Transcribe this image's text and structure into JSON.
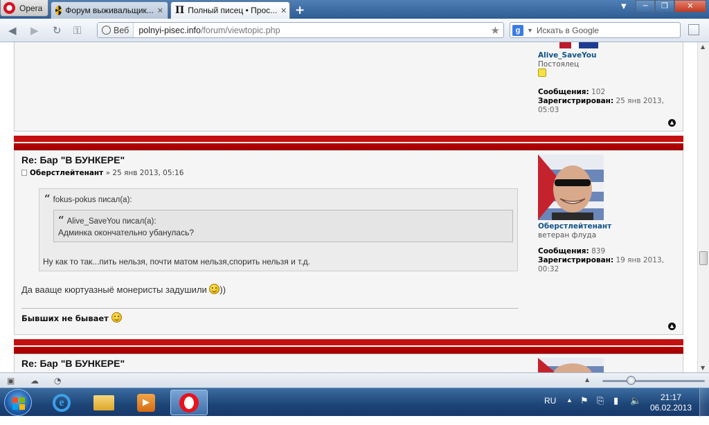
{
  "browser": {
    "opera_button": "Opera",
    "tabs": [
      {
        "label": "Форум выживальщик..."
      },
      {
        "label": "Полный писец • Прос..."
      }
    ],
    "win": {
      "min": "─",
      "max": "❐",
      "close": "✕"
    }
  },
  "address": {
    "badge": "Веб",
    "url_host": "polnyi-pisec.info",
    "url_path": "/forum/viewtopic.php",
    "search_placeholder": "Искать в Google"
  },
  "post_prev": {
    "username": "Alive_SaveYou",
    "rank": "Постоялец",
    "posts_label": "Сообщения:",
    "posts_value": "102",
    "reg_label": "Зарегистрирован:",
    "reg_value": "25 янв 2013, 05:03"
  },
  "post_main": {
    "title": "Re: Бар \"В БУНКЕРЕ\"",
    "author": "Оберстлейтенант",
    "date": "» 25 янв 2013, 05:16",
    "quote_outer_author": "fokus-pokus писал(а):",
    "quote_inner_author": "Alive_SaveYou писал(а):",
    "quote_inner_text": "Админка окончательно убанулась?",
    "quote_outer_text": "Ну как то так...пить нельзя, почти матом нельзя,спорить нельзя и т.д.",
    "body_text": "Да вааще кюртуазныё монеристы задушили",
    "body_suffix": "))",
    "signature": "Бывших не бывает",
    "profile": {
      "username": "Оберстлейтенант",
      "rank": "ветеран флуда",
      "posts_label": "Сообщения:",
      "posts_value": "839",
      "reg_label": "Зарегистрирован:",
      "reg_value": "19 янв 2013, 00:32"
    }
  },
  "post_next": {
    "title": "Re: Бар \"В БУНКЕРЕ\""
  },
  "taskbar": {
    "lang": "RU",
    "time": "21:17",
    "date": "06.02.2013"
  }
}
